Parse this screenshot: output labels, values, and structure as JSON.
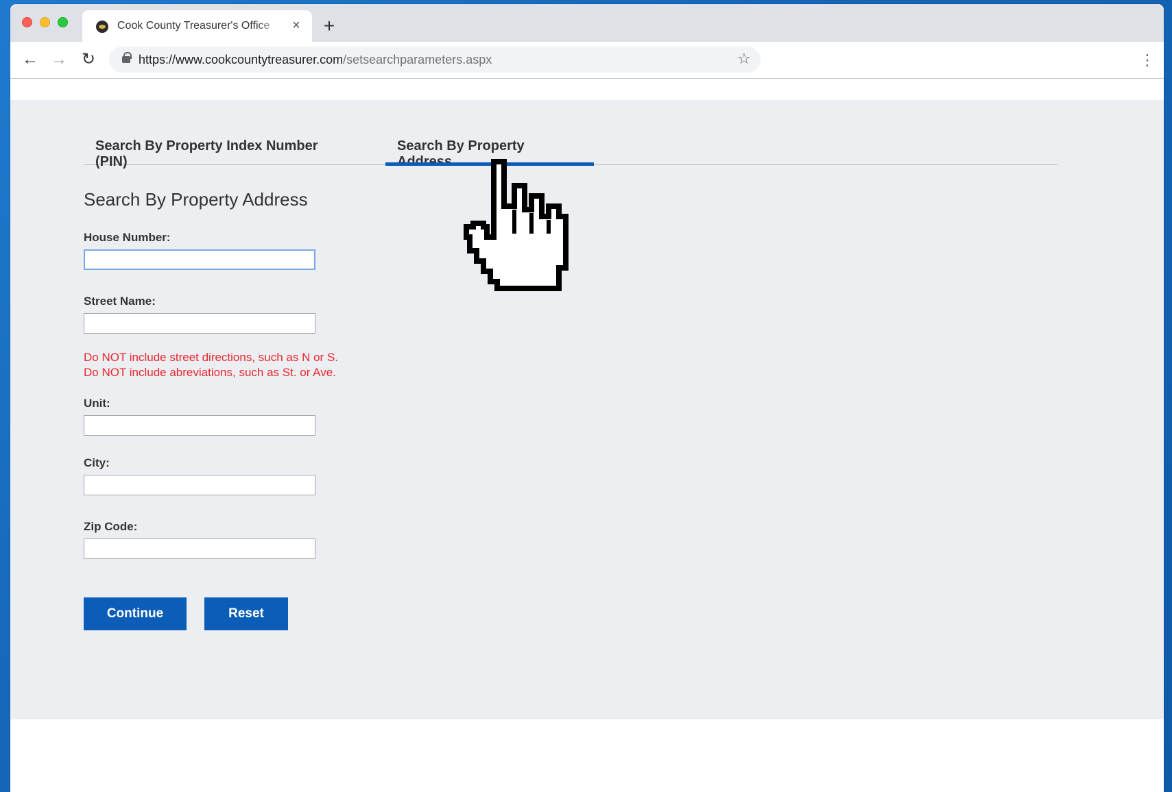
{
  "browser": {
    "tab_title": "Cook County Treasurer's Office",
    "tab_close": "×",
    "new_tab": "+",
    "url_domain": "https://www.cookcountytreasurer.com",
    "url_path": "/setsearchparameters.aspx",
    "nav": {
      "back": "←",
      "forward": "→",
      "reload": "↻",
      "star": "☆",
      "menu": "⋮"
    }
  },
  "page": {
    "tabs": [
      {
        "label": "Search By Property Index Number (PIN)"
      },
      {
        "label": "Search By Property Address"
      }
    ],
    "form_title": "Search By Property Address",
    "fields": {
      "house_number": {
        "label": "House Number:",
        "value": ""
      },
      "street_name": {
        "label": "Street Name:",
        "value": ""
      },
      "unit": {
        "label": "Unit:",
        "value": ""
      },
      "city": {
        "label": "City:",
        "value": ""
      },
      "zip": {
        "label": "Zip Code:",
        "value": ""
      }
    },
    "warnings": [
      "Do NOT include street directions, such as N or S.",
      "Do NOT include abreviations, such as St. or Ave."
    ],
    "buttons": {
      "continue": "Continue",
      "reset": "Reset"
    }
  },
  "colors": {
    "accent": "#0b5db7",
    "warning": "#e8262d",
    "content_bg": "#edeef2"
  },
  "icons": [
    "lock-icon",
    "star-icon",
    "hand-pointer-cursor-icon"
  ]
}
